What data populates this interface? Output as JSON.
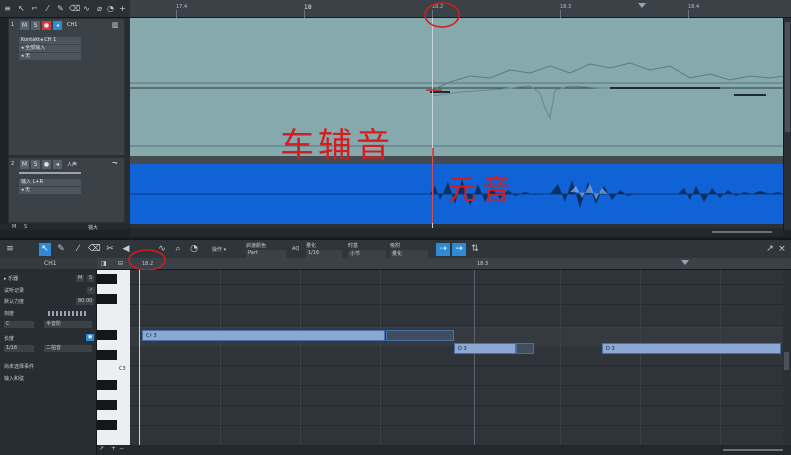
{
  "top_ruler": {
    "labels": [
      "17.4",
      "18",
      "18.2",
      "18.3",
      "18.4"
    ]
  },
  "track1": {
    "number": "1",
    "m_label": "M",
    "s_label": "S",
    "name": "CH1",
    "instrument_label": "Kontakt◂",
    "instrument_channel": "CH 1",
    "input_label": "◂ 全部输入",
    "output_label": "◂ 无"
  },
  "track2": {
    "number": "2",
    "m_label": "M",
    "s_label": "S",
    "name": "人声",
    "input_label": "输入 L+R",
    "output_label": "◂ 无"
  },
  "track_footer": {
    "m_label": "M",
    "s_label": "S",
    "zoom_label": "锚大"
  },
  "annotations": {
    "left_text": "车辅音",
    "right_text": "元音"
  },
  "editor_toolbar": {
    "action_label": "操作",
    "velocity_label": "启速颜色",
    "velocity_value": "Part",
    "quantize_label": "量化",
    "quantize_value": "1/16",
    "timebase_label": "时基",
    "timebase_value": "小节",
    "snap_label": "吸附",
    "snap_value": "量化",
    "aq_label": "AQ"
  },
  "inspector": {
    "title": "CH1",
    "instrument_label": "乐器",
    "m_label": "M",
    "s_label": "S",
    "record_label": "试听记录",
    "velocity_label": "默认力度",
    "velocity_value": "80.00",
    "scale_label": "刻度",
    "key_value": "C",
    "mode_value": "半音阶",
    "length_label": "长度",
    "length_value": "1/16",
    "length_mode": "二拍音",
    "no_event_label": "尚未选择事件",
    "input_quantize_label": "输入和弦"
  },
  "editor_ruler": {
    "labels": [
      "18.2",
      "18.3"
    ]
  },
  "piano": {
    "c_label": "C3"
  },
  "notes": [
    {
      "label": "C♯ 3"
    },
    {
      "label": "D 3"
    },
    {
      "label": "D 3"
    }
  ],
  "colors": {
    "accent": "#2f8ad6",
    "lane_instrument": "#86a9ae",
    "lane_audio": "#0f63d6",
    "note": "#8ba8d4",
    "annotation": "#d21e1e"
  }
}
